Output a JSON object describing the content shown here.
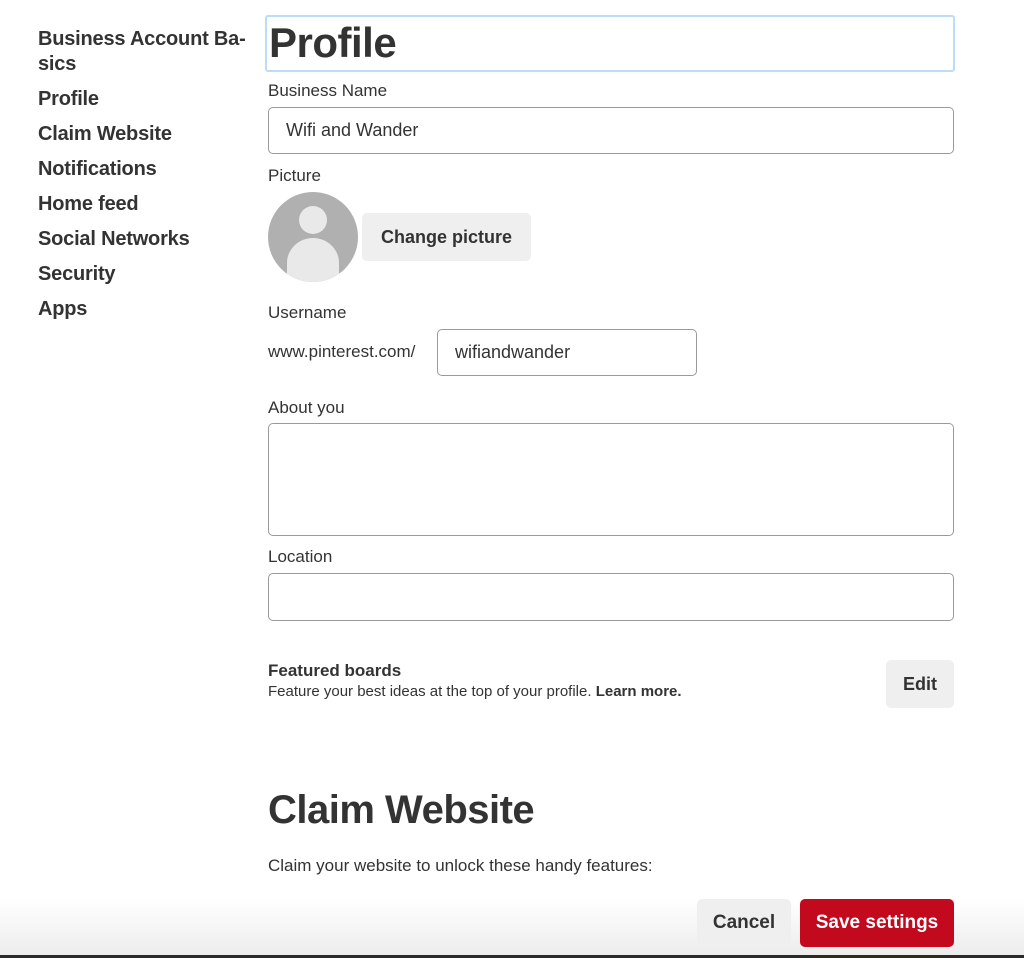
{
  "sidebar": {
    "items": [
      {
        "label": "Business Account Ba-sics"
      },
      {
        "label": "Profile"
      },
      {
        "label": "Claim Website"
      },
      {
        "label": "Notifications"
      },
      {
        "label": "Home feed"
      },
      {
        "label": "Social Networks"
      },
      {
        "label": "Security"
      },
      {
        "label": "Apps"
      }
    ]
  },
  "profile": {
    "title": "Profile",
    "business_name_label": "Business Name",
    "business_name_value": "Wifi and Wander",
    "picture_label": "Picture",
    "avatar_icon": "default-user-avatar",
    "change_picture_label": "Change picture",
    "username_label": "Username",
    "username_prefix": "www.pinterest.com/",
    "username_value": "wifiandwander",
    "about_label": "About you",
    "about_value": "",
    "location_label": "Location",
    "location_value": ""
  },
  "featured_boards": {
    "title": "Featured boards",
    "description": "Feature your best ideas at the top of your profile. ",
    "learn_more": "Learn more.",
    "edit_label": "Edit"
  },
  "claim_website": {
    "title": "Claim Website",
    "description": "Claim your website to unlock these handy features:"
  },
  "footer": {
    "cancel_label": "Cancel",
    "save_label": "Save settings",
    "save_color": "#c2091d"
  }
}
